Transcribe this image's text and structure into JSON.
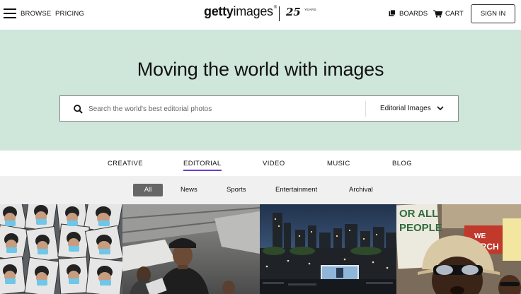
{
  "header": {
    "browse_label": "BROWSE",
    "pricing_label": "PRICING",
    "logo_main": "getty",
    "logo_secondary": "images",
    "logo_mark": "®",
    "anniversary_number": "25",
    "anniversary_label": "YEARS",
    "boards_label": "BOARDS",
    "cart_label": "CART",
    "signin_label": "SIGN IN"
  },
  "hero": {
    "title": "Moving the world with images",
    "search_placeholder": "Search the world's best editorial photos",
    "search_type": "Editorial Images",
    "background_color": "#cfe6da"
  },
  "category_tabs": [
    {
      "label": "CREATIVE",
      "active": false
    },
    {
      "label": "EDITORIAL",
      "active": true
    },
    {
      "label": "VIDEO",
      "active": false
    },
    {
      "label": "MUSIC",
      "active": false
    },
    {
      "label": "BLOG",
      "active": false
    }
  ],
  "sub_tabs": [
    {
      "label": "All",
      "active": true
    },
    {
      "label": "News",
      "active": false
    },
    {
      "label": "Sports",
      "active": false
    },
    {
      "label": "Entertainment",
      "active": false
    },
    {
      "label": "Archival",
      "active": false
    }
  ],
  "photos": {
    "protest_sign_1": "OR ALL",
    "protest_sign_2": "PEOPLE",
    "protest_sign_3": "WE",
    "protest_sign_4": "MARCH"
  },
  "colors": {
    "accent_underline": "#6b3fd0",
    "active_subtab": "#666666"
  }
}
